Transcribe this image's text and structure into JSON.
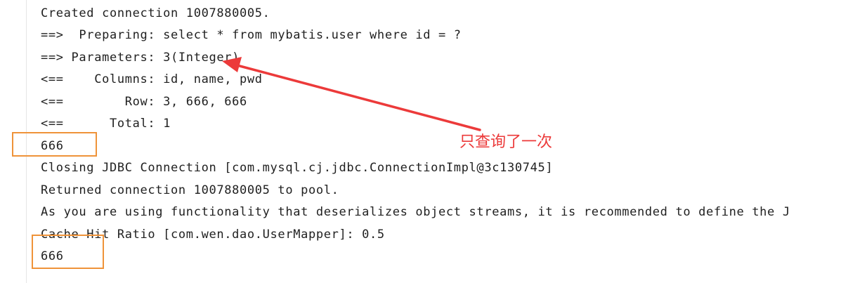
{
  "console": {
    "lines": [
      "Created connection 1007880005.",
      "==>  Preparing: select * from mybatis.user where id = ?",
      "==> Parameters: 3(Integer)",
      "<==    Columns: id, name, pwd",
      "<==        Row: 3, 666, 666",
      "<==      Total: 1",
      "666",
      "Closing JDBC Connection [com.mysql.cj.jdbc.ConnectionImpl@3c130745]",
      "Returned connection 1007880005 to pool.",
      "As you are using functionality that deserializes object streams, it is recommended to define the J",
      "Cache Hit Ratio [com.wen.dao.UserMapper]: 0.5",
      "666"
    ]
  },
  "annotation": {
    "text": "只查询了一次",
    "color": "#ec3a3a",
    "box_color": "#ef9339"
  }
}
